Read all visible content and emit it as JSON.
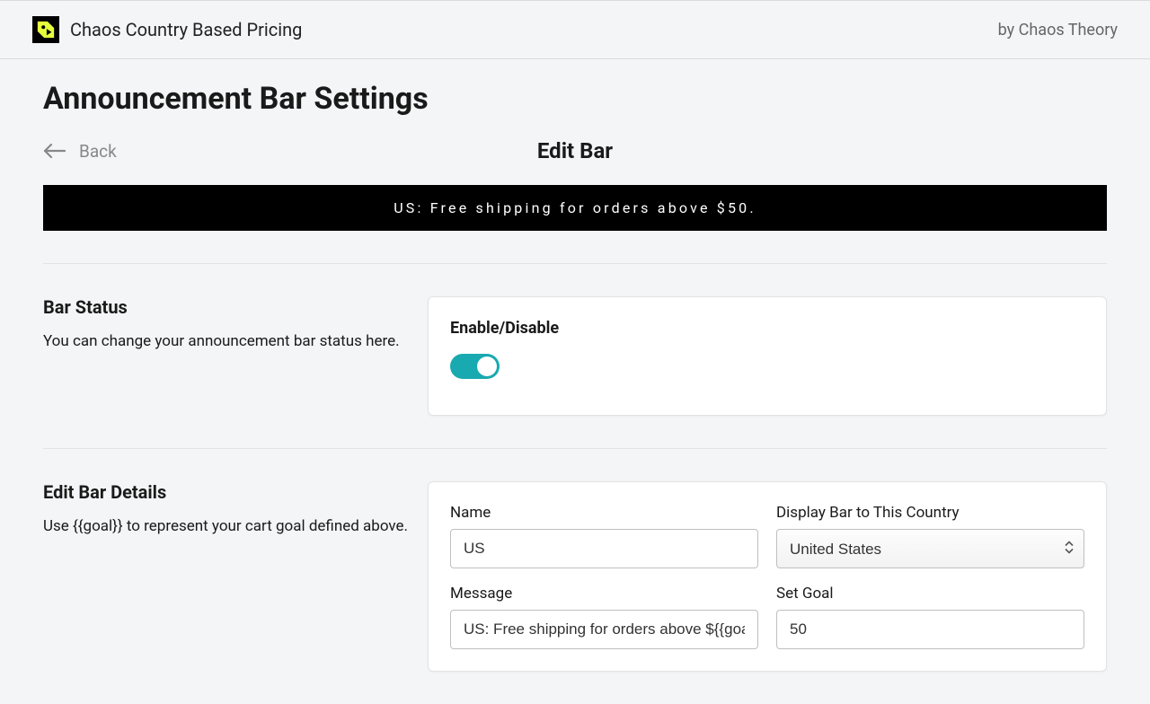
{
  "header": {
    "brand": "Chaos Country Based Pricing",
    "byline": "by Chaos Theory"
  },
  "page": {
    "title": "Announcement Bar Settings",
    "back_label": "Back",
    "subtitle": "Edit Bar",
    "preview_text": "US: Free shipping for orders above $50."
  },
  "status_section": {
    "heading": "Bar Status",
    "description": "You can change your announcement bar status here.",
    "enable_label": "Enable/Disable",
    "enabled": true
  },
  "details_section": {
    "heading": "Edit Bar Details",
    "description": "Use {{goal}} to represent your cart goal defined above.",
    "fields": {
      "name_label": "Name",
      "name_value": "US",
      "country_label": "Display Bar to This Country",
      "country_value": "United States",
      "message_label": "Message",
      "message_value": "US: Free shipping for orders above ${{goal}}",
      "goal_label": "Set Goal",
      "goal_value": "50"
    }
  }
}
